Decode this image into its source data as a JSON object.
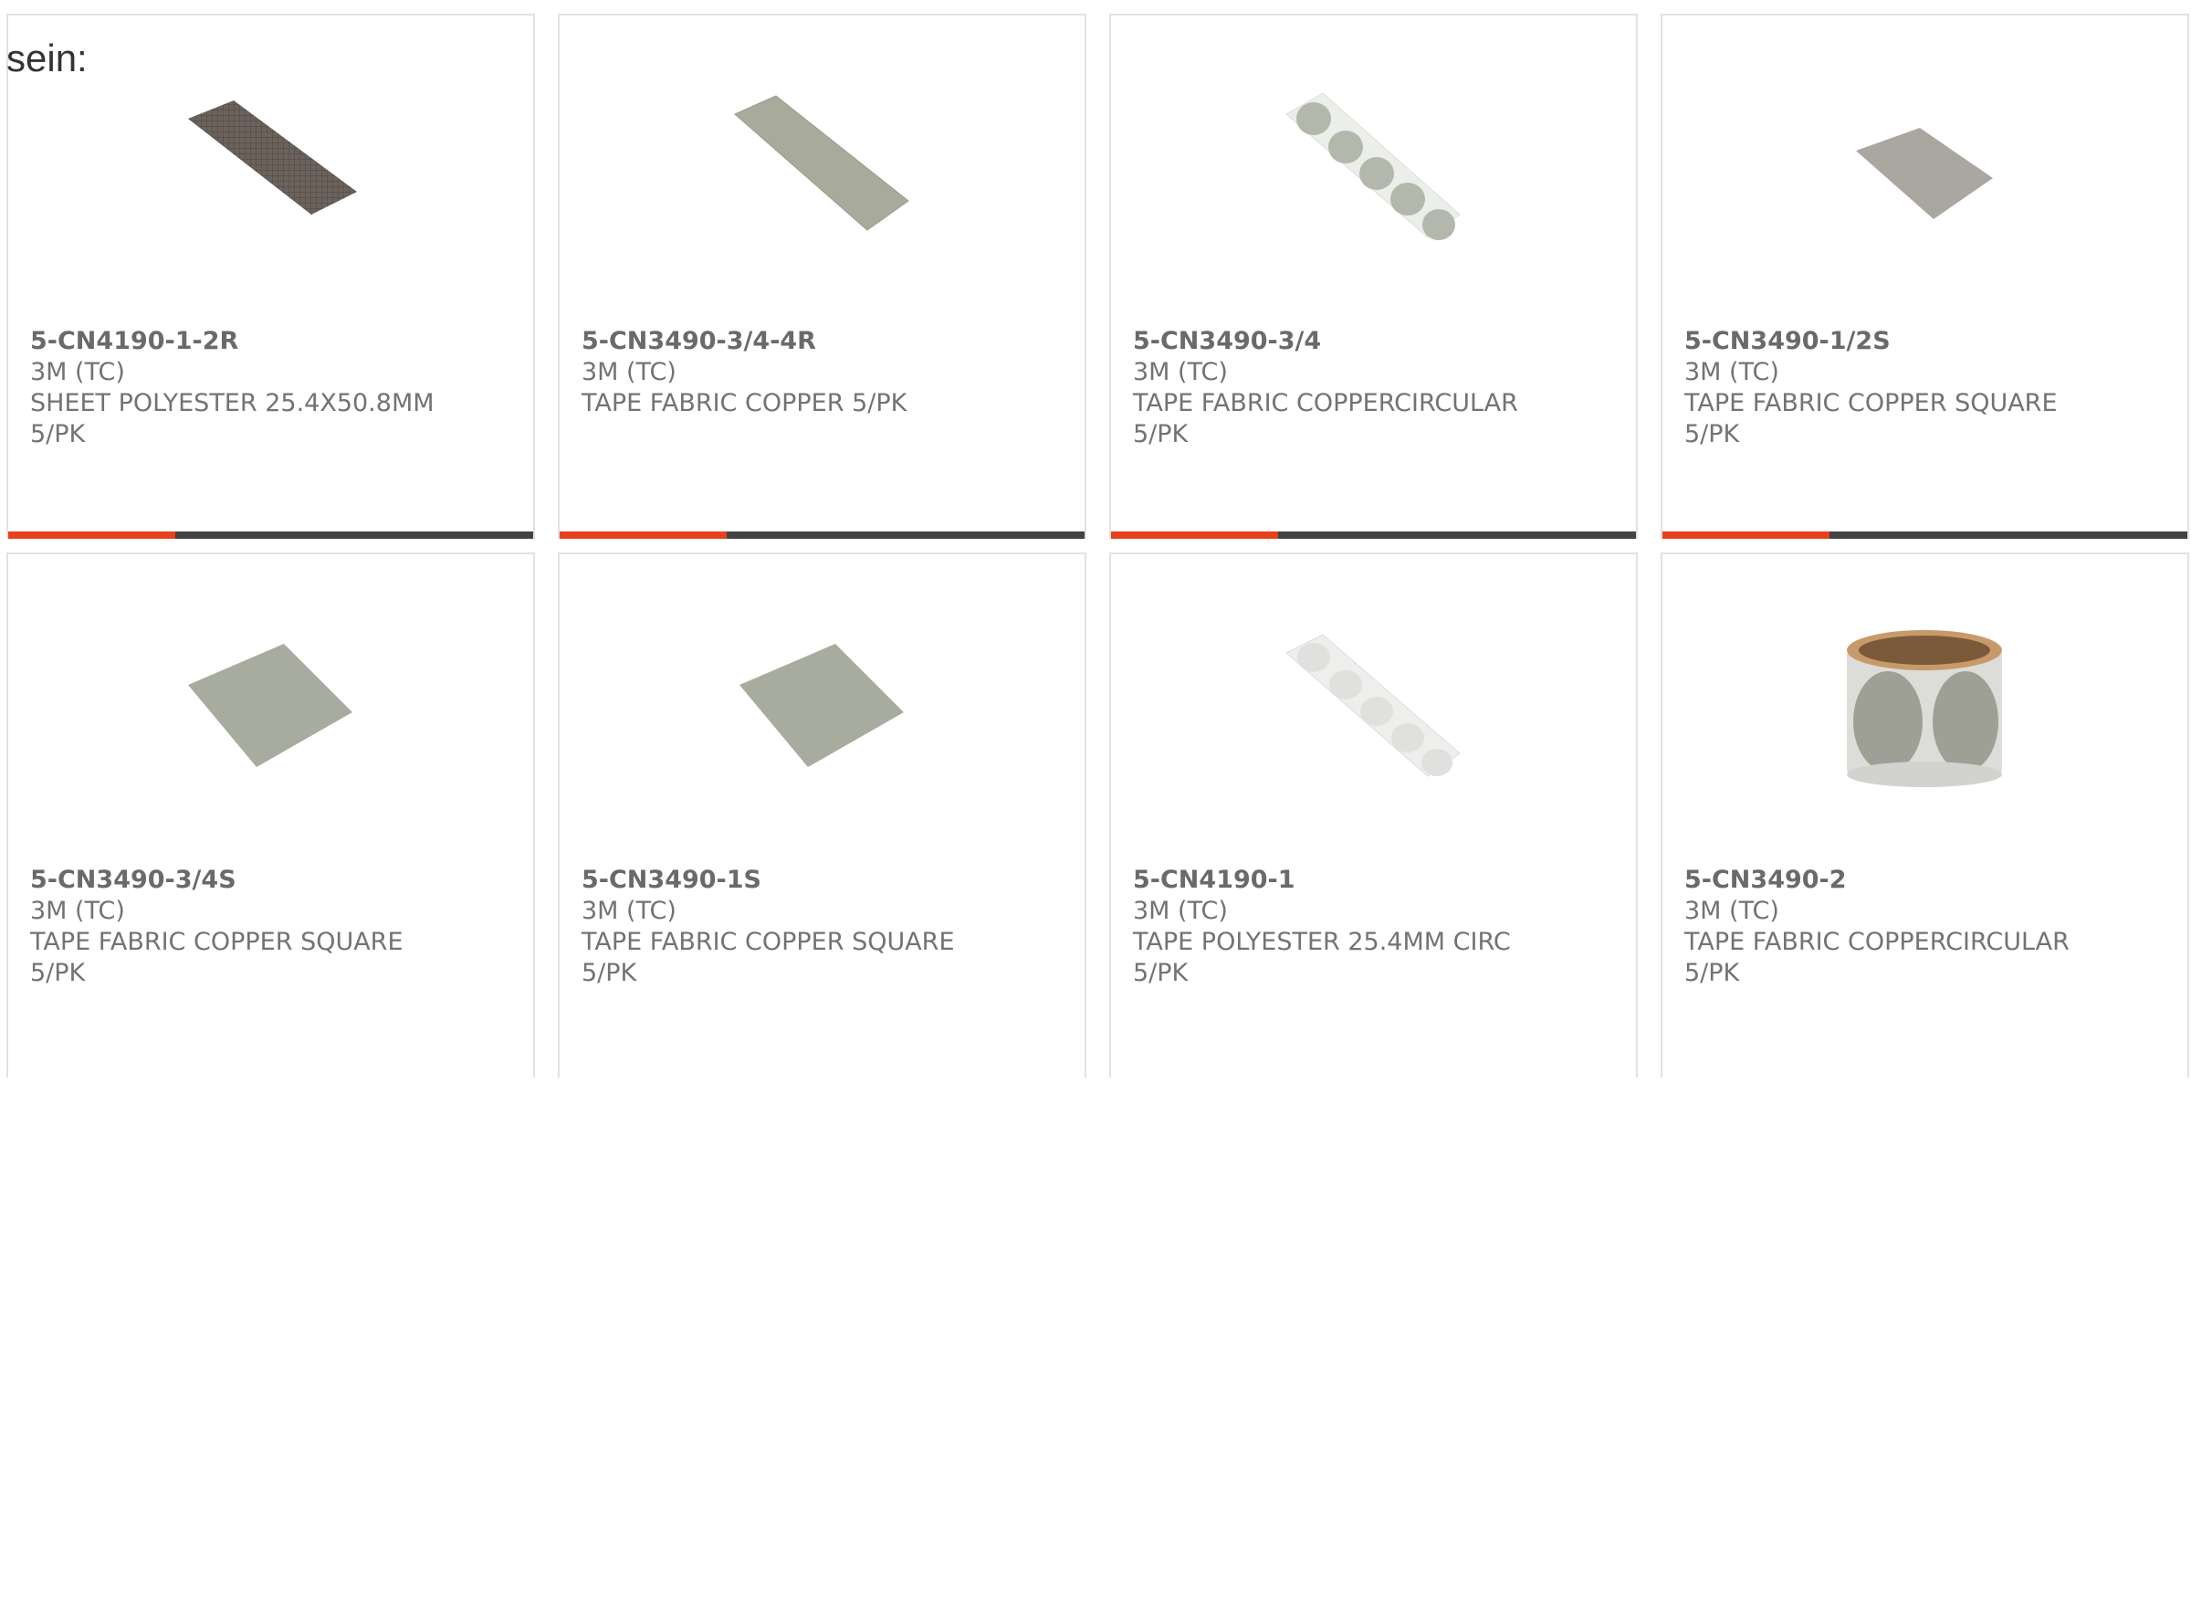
{
  "heading": "sein:",
  "products": [
    {
      "part_number": "5-CN4190-1-2R",
      "manufacturer": "3M (TC)",
      "description": "SHEET POLYESTER 25.4X50.8MM",
      "package": "5/PK",
      "image_icon": "dark-sheet-strip-image"
    },
    {
      "part_number": "5-CN3490-3/4-4R",
      "manufacturer": "3M (TC)",
      "description": "TAPE FABRIC COPPER 5/PK",
      "package": "",
      "image_icon": "fabric-strip-image"
    },
    {
      "part_number": "5-CN3490-3/4",
      "manufacturer": "3M (TC)",
      "description": "TAPE FABRIC COPPERCIRCULAR",
      "package": "5/PK",
      "image_icon": "circle-dots-strip-image"
    },
    {
      "part_number": "5-CN3490-1/2S",
      "manufacturer": "3M (TC)",
      "description": "TAPE FABRIC COPPER SQUARE",
      "package": "5/PK",
      "image_icon": "small-square-image"
    },
    {
      "part_number": "5-CN3490-3/4S",
      "manufacturer": "3M (TC)",
      "description": "TAPE FABRIC COPPER SQUARE",
      "package": "5/PK",
      "image_icon": "fabric-square-image"
    },
    {
      "part_number": "5-CN3490-1S",
      "manufacturer": "3M (TC)",
      "description": "TAPE FABRIC COPPER SQUARE",
      "package": "5/PK",
      "image_icon": "fabric-square-image"
    },
    {
      "part_number": "5-CN4190-1",
      "manufacturer": "3M (TC)",
      "description": "TAPE POLYESTER 25.4MM CIRC",
      "package": "5/PK",
      "image_icon": "faint-circle-strip-image"
    },
    {
      "part_number": "5-CN3490-2",
      "manufacturer": "3M (TC)",
      "description": "TAPE FABRIC COPPERCIRCULAR",
      "package": "5/PK",
      "image_icon": "tape-roll-image"
    }
  ],
  "colors": {
    "accent_bar": "#e8401c",
    "dark_bar": "#434343",
    "text": "#737373",
    "border": "#e2e2e2"
  }
}
